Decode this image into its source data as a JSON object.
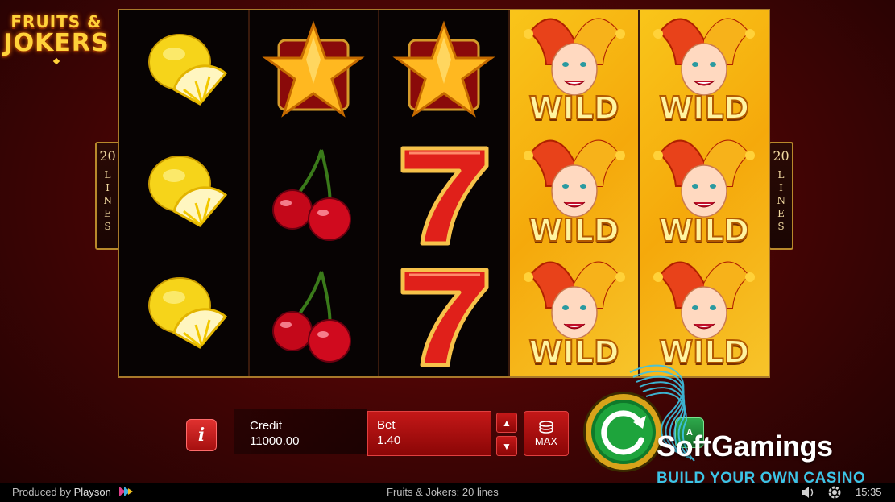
{
  "logo": {
    "line1": "FRUITS &",
    "line2": "JOKERS"
  },
  "paylines": {
    "count": "20",
    "word": "LINES"
  },
  "reels": [
    [
      "lemon",
      "lemon",
      "lemon"
    ],
    [
      "star",
      "cherry",
      "cherry"
    ],
    [
      "star",
      "seven",
      "seven"
    ],
    [
      "wild",
      "wild",
      "wild"
    ],
    [
      "wild",
      "wild",
      "wild"
    ]
  ],
  "wild_text": "WILD",
  "controls": {
    "info_label": "i",
    "credit_label": "Credit",
    "credit_value": "11000.00",
    "bet_label": "Bet",
    "bet_value": "1.40",
    "bet_up": "▲",
    "bet_down": "▼",
    "max_label": "MAX",
    "autoplay_label": "A"
  },
  "watermark": {
    "name": "SoftGamings",
    "tagline": "BUILD YOUR OWN CASINO"
  },
  "footer": {
    "produced_prefix": "Produced by",
    "producer": "Playson",
    "game_title": "Fruits & Jokers: 20 lines",
    "clock": "15:35"
  },
  "colors": {
    "frame_gold": "#a8792a",
    "button_red": "#c41818",
    "wild_gold": "#f7c42a",
    "tagline_blue": "#3cc4e6"
  }
}
